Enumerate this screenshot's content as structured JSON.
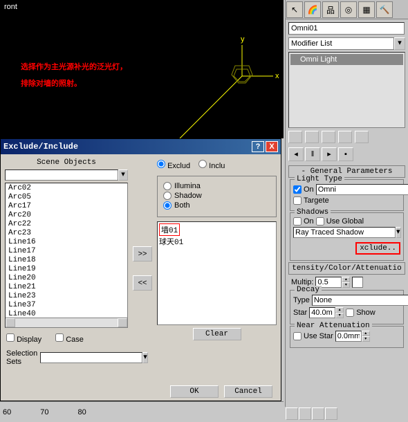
{
  "viewport": {
    "label": "ront",
    "annotation_line1": "选择作为主光源补光的泛光灯，",
    "annotation_line2": "排除对墙的照射。",
    "axis_y": "y",
    "axis_x": "x"
  },
  "panel": {
    "object_name": "Omni01",
    "modifier_dropdown": "Modifier List",
    "stack_item": "Omni Light",
    "rollout_general": "- General Parameters",
    "group_light_type": "Light Type",
    "on_label": "On",
    "light_type_value": "Omni",
    "targeted_label": "Targete",
    "group_shadows": "Shadows",
    "use_global_label": "Use Global",
    "shadow_type": "Ray Traced Shadow",
    "exclude_button": "xclude..",
    "rollout_intensity": "tensity/Color/Attenuatio",
    "multip_label": "Multip:",
    "multip_value": "0.5",
    "group_decay": "Decay",
    "type_label": "Type",
    "decay_type": "None",
    "decay_start_label": "Star",
    "decay_start_value": "40.0m",
    "show_label": "Show",
    "group_near_atten": "Near Attenuation",
    "use_label": "Use",
    "near_start_label": "Star",
    "near_start_value": "0.0mm"
  },
  "dialog": {
    "title": "Exclude/Include",
    "scene_objects_label": "Scene Objects",
    "scene_items": [
      "Arc02",
      "Arc05",
      "Arc17",
      "Arc20",
      "Arc22",
      "Arc23",
      "Line16",
      "Line17",
      "Line18",
      "Line19",
      "Line20",
      "Line21",
      "Line23",
      "Line37",
      "Line40"
    ],
    "display_label": "Display",
    "case_label": "Case",
    "selection_sets_label": "Selection\nSets",
    "exclude_radio": "Exclud",
    "include_radio": "Inclu",
    "illumina_radio": "Illumina",
    "shadow_radio": "Shadow",
    "both_radio": "Both",
    "target_item1": "墙01",
    "target_item2": "球天01",
    "clear_button": "Clear",
    "ok_button": "OK",
    "cancel_button": "Cancel"
  },
  "timeline": {
    "ticks": [
      "60",
      "70",
      "80"
    ]
  }
}
